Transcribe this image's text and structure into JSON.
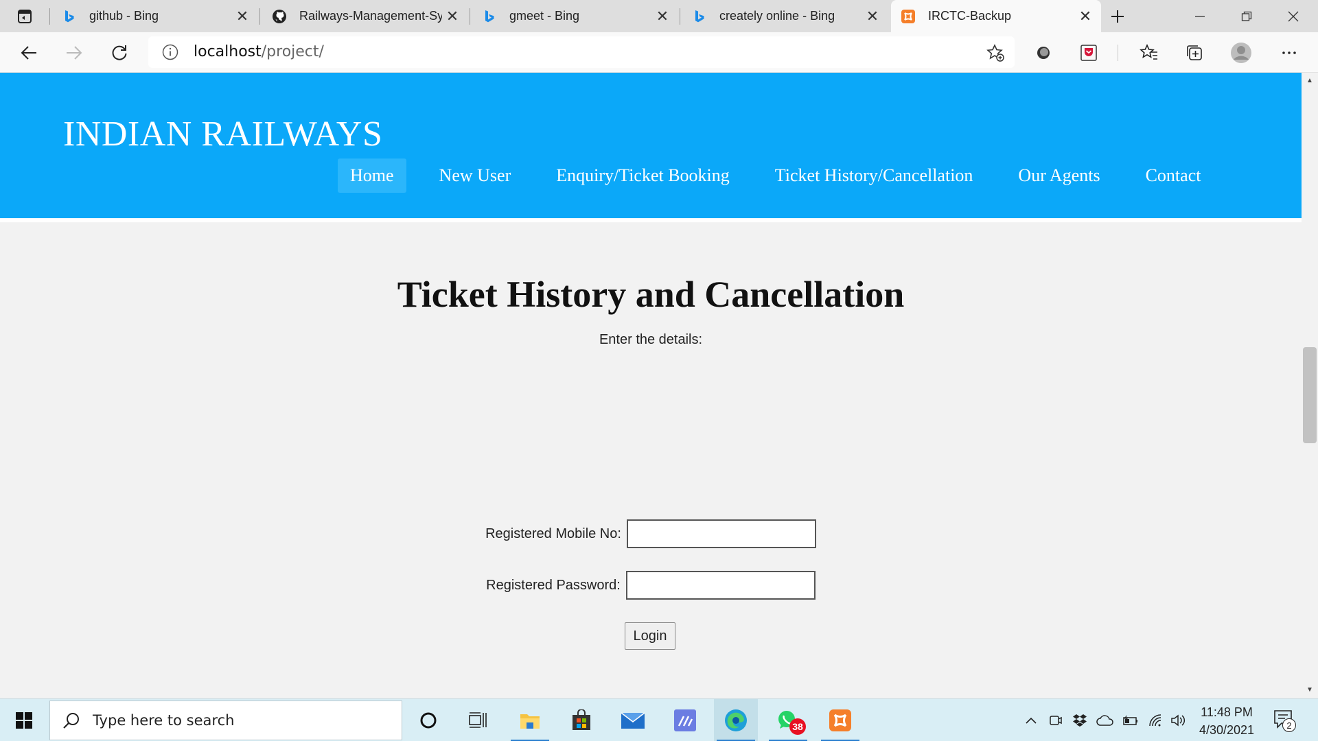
{
  "browser": {
    "tabs": [
      {
        "title": "github - Bing",
        "favicon": "bing-icon"
      },
      {
        "title": "Railways-Management-Sy",
        "favicon": "github-icon"
      },
      {
        "title": "gmeet - Bing",
        "favicon": "bing-icon"
      },
      {
        "title": "creately online - Bing",
        "favicon": "bing-icon"
      },
      {
        "title": "IRCTC-Backup",
        "favicon": "xampp-icon",
        "active": true
      }
    ],
    "url_host": "localhost",
    "url_path": "/project/"
  },
  "site": {
    "title": "INDIAN RAILWAYS",
    "header_color": "#0ba8f9",
    "menu": [
      {
        "label": "Home",
        "active": true
      },
      {
        "label": "New User"
      },
      {
        "label": "Enquiry/Ticket Booking"
      },
      {
        "label": "Ticket History/Cancellation"
      },
      {
        "label": "Our Agents"
      },
      {
        "label": "Contact"
      }
    ]
  },
  "form": {
    "heading": "Ticket History and Cancellation",
    "subtitle": "Enter the details:",
    "mobile_label": "Registered Mobile No:",
    "mobile_value": "",
    "password_label": "Registered Password:",
    "password_value": "",
    "submit_label": "Login"
  },
  "taskbar": {
    "search_placeholder": "Type here to search",
    "whatsapp_badge": "38",
    "time": "11:48 PM",
    "date": "4/30/2021",
    "notification_count": "2"
  }
}
